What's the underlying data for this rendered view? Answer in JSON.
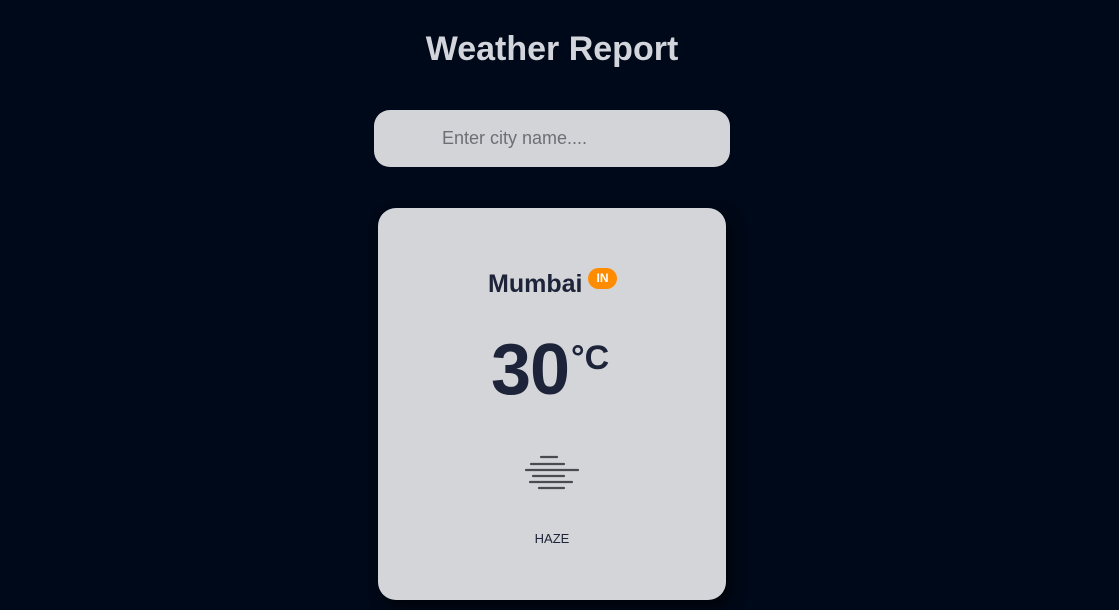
{
  "header": {
    "title": "Weather Report"
  },
  "search": {
    "placeholder": "Enter city name....",
    "value": ""
  },
  "weather": {
    "city": "Mumbai",
    "country_code": "IN",
    "temperature": "30",
    "unit": "°C",
    "condition": "HAZE",
    "icon": "haze-icon"
  },
  "colors": {
    "background": "#000919",
    "card": "#d4d5d8",
    "badge": "#ff8c00",
    "text_dark": "#1d2338",
    "title": "#d3d5dc"
  }
}
